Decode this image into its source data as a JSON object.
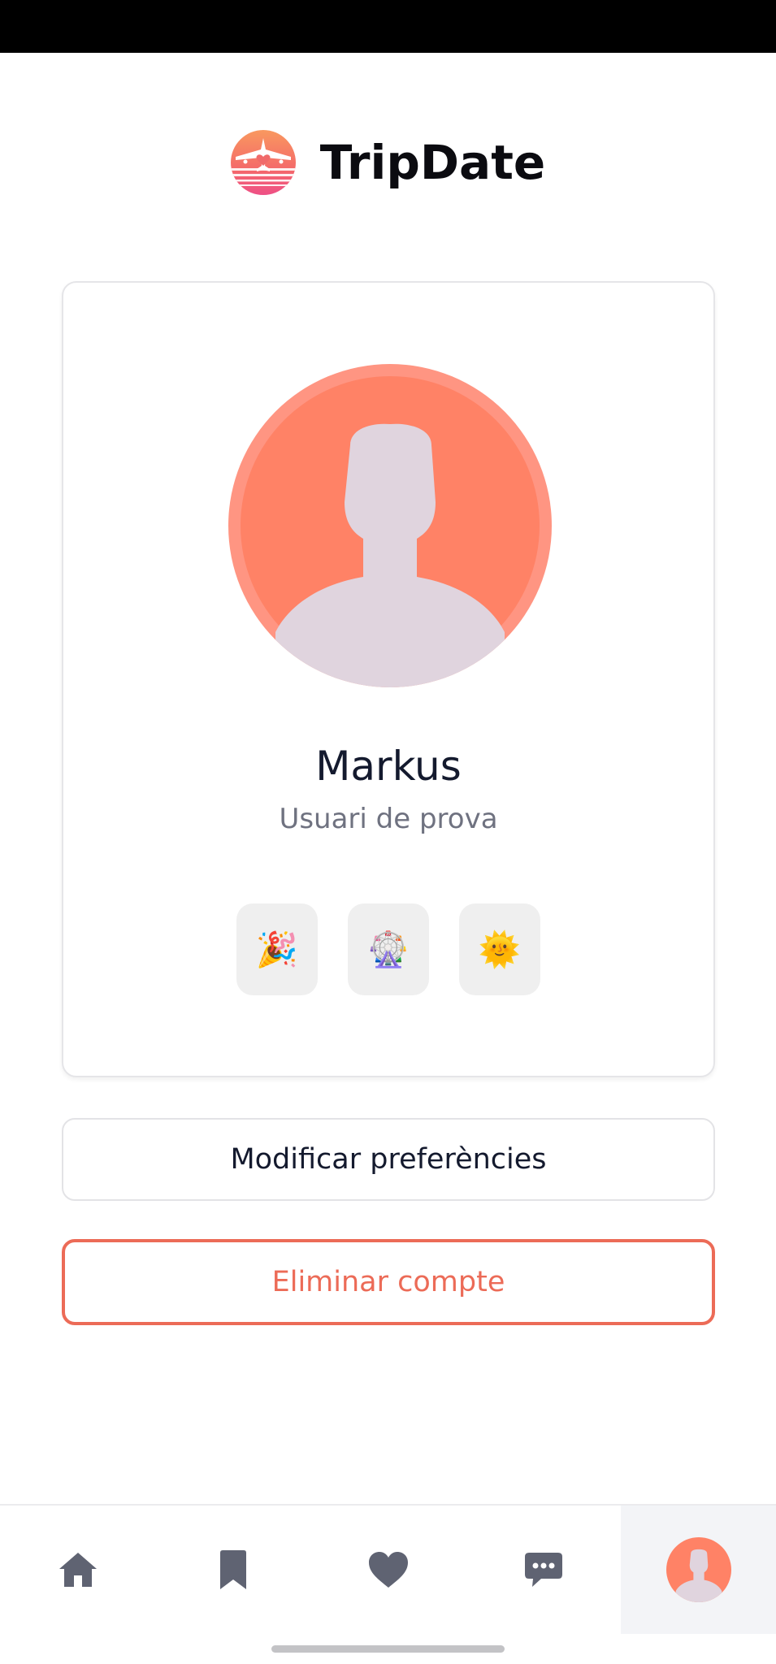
{
  "app": {
    "title": "TripDate"
  },
  "icons": {
    "logo": "airplane-sunset-logo",
    "avatar": "person-silhouette-icon"
  },
  "profile": {
    "name": "Markus",
    "subtitle": "Usuari de prova",
    "badges": [
      {
        "emoji": "🎉",
        "icon": "party-popper-icon"
      },
      {
        "emoji": "🎡",
        "icon": "ferris-wheel-icon"
      },
      {
        "emoji": "🌞",
        "icon": "sun-with-face-icon"
      }
    ]
  },
  "actions": {
    "edit_preferences": "Modificar preferències",
    "delete_account": "Eliminar compte"
  },
  "bottom_nav": {
    "items": [
      {
        "icon": "home-icon"
      },
      {
        "icon": "bookmark-icon"
      },
      {
        "icon": "heart-icon"
      },
      {
        "icon": "chat-icon"
      },
      {
        "icon": "profile-avatar-icon",
        "active": true
      }
    ]
  },
  "colors": {
    "accent": "#ec6b57",
    "avatar_bg": "#ff8266",
    "nav_icon": "#5f6372",
    "text_dark": "#141a2e"
  }
}
